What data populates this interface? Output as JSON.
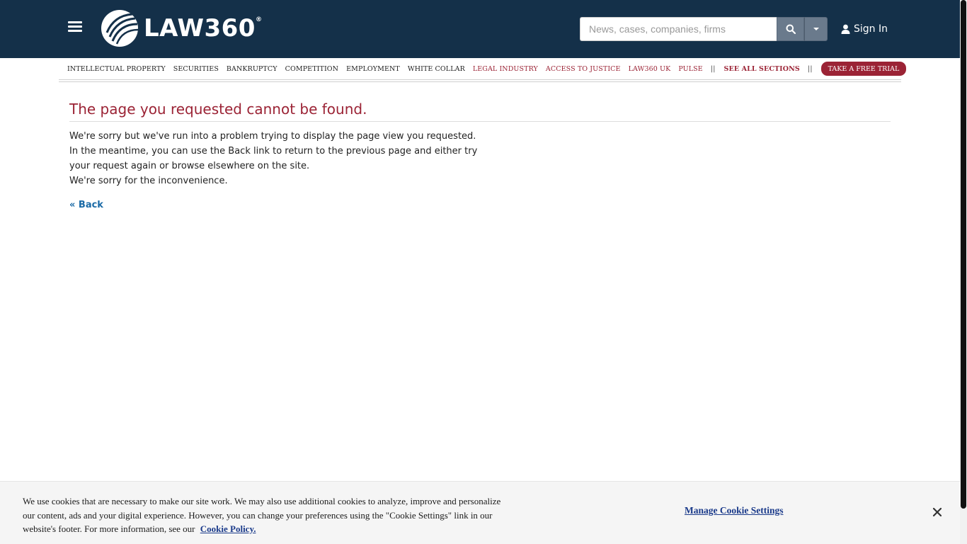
{
  "header": {
    "logo_text": "LAW360",
    "logo_reg": "®",
    "search_placeholder": "News, cases, companies, firms",
    "signin_label": "Sign In",
    "background_color": "#143049"
  },
  "nav": {
    "items": [
      {
        "label": "INTELLECTUAL PROPERTY"
      },
      {
        "label": "SECURITIES"
      },
      {
        "label": "BANKRUPTCY"
      },
      {
        "label": "COMPETITION"
      },
      {
        "label": "EMPLOYMENT"
      },
      {
        "label": "WHITE COLLAR"
      },
      {
        "label": "LEGAL INDUSTRY"
      },
      {
        "label": "ACCESS TO JUSTICE"
      },
      {
        "label": "LAW360 UK"
      },
      {
        "label": "PULSE"
      }
    ],
    "separator": "||",
    "see_all": "SEE ALL SECTIONS",
    "trial_label": "TAKE A FREE TRIAL",
    "accent_color": "#9b2335"
  },
  "content": {
    "title": "The page you requested cannot be found.",
    "line1": "We're sorry but we've run into a problem trying to display the page view you requested.",
    "line2": "In the meantime, you can use the Back link to return to the previous page and either try your request again or browse elsewhere on the site.",
    "line3": "We're sorry for the inconvenience.",
    "back_label": "« Back"
  },
  "cookie": {
    "text": "We use cookies that are necessary to make our site work. We may also use additional cookies to analyze, improve and personalize our content, ads and your digital experience. However, you can change your preferences using the \"Cookie Settings\" link in our website's footer. For more information, see our",
    "policy_label": "Cookie Policy.",
    "manage_label": "Manage Cookie Settings"
  }
}
